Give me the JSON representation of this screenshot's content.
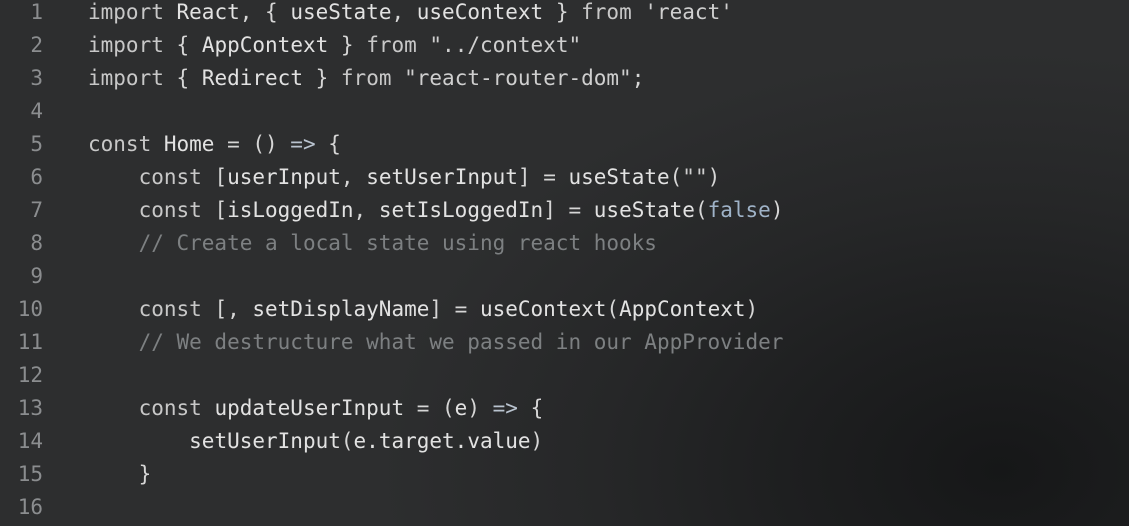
{
  "editor": {
    "lines": [
      {
        "number": "1",
        "tokens": [
          {
            "text": "import ",
            "kind": "kw"
          },
          {
            "text": "React",
            "kind": "id"
          },
          {
            "text": ", { ",
            "kind": "p"
          },
          {
            "text": "useState",
            "kind": "id"
          },
          {
            "text": ", ",
            "kind": "p"
          },
          {
            "text": "useContext",
            "kind": "id"
          },
          {
            "text": " } ",
            "kind": "p"
          },
          {
            "text": "from ",
            "kind": "kw"
          },
          {
            "text": "'react'",
            "kind": "str"
          }
        ]
      },
      {
        "number": "2",
        "tokens": [
          {
            "text": "import ",
            "kind": "kw"
          },
          {
            "text": "{ ",
            "kind": "p"
          },
          {
            "text": "AppContext",
            "kind": "id"
          },
          {
            "text": " } ",
            "kind": "p"
          },
          {
            "text": "from ",
            "kind": "kw"
          },
          {
            "text": "\"../context\"",
            "kind": "str"
          }
        ]
      },
      {
        "number": "3",
        "tokens": [
          {
            "text": "import ",
            "kind": "kw"
          },
          {
            "text": "{ ",
            "kind": "p"
          },
          {
            "text": "Redirect",
            "kind": "id"
          },
          {
            "text": " } ",
            "kind": "p"
          },
          {
            "text": "from ",
            "kind": "kw"
          },
          {
            "text": "\"react-router-dom\"",
            "kind": "str"
          },
          {
            "text": ";",
            "kind": "p"
          }
        ]
      },
      {
        "number": "4",
        "tokens": []
      },
      {
        "number": "5",
        "tokens": [
          {
            "text": "const ",
            "kind": "kw"
          },
          {
            "text": "Home",
            "kind": "id"
          },
          {
            "text": " = () ",
            "kind": "p"
          },
          {
            "text": "=>",
            "kind": "op"
          },
          {
            "text": " {",
            "kind": "p"
          }
        ]
      },
      {
        "number": "6",
        "tokens": [
          {
            "text": "    ",
            "kind": "p"
          },
          {
            "text": "const ",
            "kind": "kw"
          },
          {
            "text": "[",
            "kind": "p"
          },
          {
            "text": "userInput",
            "kind": "id"
          },
          {
            "text": ", ",
            "kind": "p"
          },
          {
            "text": "setUserInput",
            "kind": "id"
          },
          {
            "text": "] = ",
            "kind": "p"
          },
          {
            "text": "useState",
            "kind": "id"
          },
          {
            "text": "(",
            "kind": "p"
          },
          {
            "text": "\"\"",
            "kind": "str"
          },
          {
            "text": ")",
            "kind": "p"
          }
        ]
      },
      {
        "number": "7",
        "tokens": [
          {
            "text": "    ",
            "kind": "p"
          },
          {
            "text": "const ",
            "kind": "kw"
          },
          {
            "text": "[",
            "kind": "p"
          },
          {
            "text": "isLoggedIn",
            "kind": "id"
          },
          {
            "text": ", ",
            "kind": "p"
          },
          {
            "text": "setIsLoggedIn",
            "kind": "id"
          },
          {
            "text": "] = ",
            "kind": "p"
          },
          {
            "text": "useState",
            "kind": "id"
          },
          {
            "text": "(",
            "kind": "p"
          },
          {
            "text": "false",
            "kind": "lit"
          },
          {
            "text": ")",
            "kind": "p"
          }
        ]
      },
      {
        "number": "8",
        "tokens": [
          {
            "text": "    ",
            "kind": "p"
          },
          {
            "text": "// Create a local state using react hooks",
            "kind": "cm"
          }
        ]
      },
      {
        "number": "9",
        "tokens": []
      },
      {
        "number": "10",
        "tokens": [
          {
            "text": "    ",
            "kind": "p"
          },
          {
            "text": "const ",
            "kind": "kw"
          },
          {
            "text": "[, ",
            "kind": "p"
          },
          {
            "text": "setDisplayName",
            "kind": "id"
          },
          {
            "text": "] = ",
            "kind": "p"
          },
          {
            "text": "useContext",
            "kind": "id"
          },
          {
            "text": "(",
            "kind": "p"
          },
          {
            "text": "AppContext",
            "kind": "id"
          },
          {
            "text": ")",
            "kind": "p"
          }
        ]
      },
      {
        "number": "11",
        "tokens": [
          {
            "text": "    ",
            "kind": "p"
          },
          {
            "text": "// We destructure what we passed in our AppProvider",
            "kind": "cm"
          }
        ]
      },
      {
        "number": "12",
        "tokens": []
      },
      {
        "number": "13",
        "tokens": [
          {
            "text": "    ",
            "kind": "p"
          },
          {
            "text": "const ",
            "kind": "kw"
          },
          {
            "text": "updateUserInput",
            "kind": "id"
          },
          {
            "text": " = (",
            "kind": "p"
          },
          {
            "text": "e",
            "kind": "id"
          },
          {
            "text": ") ",
            "kind": "p"
          },
          {
            "text": "=>",
            "kind": "op"
          },
          {
            "text": " {",
            "kind": "p"
          }
        ]
      },
      {
        "number": "14",
        "tokens": [
          {
            "text": "        ",
            "kind": "p"
          },
          {
            "text": "setUserInput",
            "kind": "id"
          },
          {
            "text": "(",
            "kind": "p"
          },
          {
            "text": "e.target.value",
            "kind": "id"
          },
          {
            "text": ")",
            "kind": "p"
          }
        ]
      },
      {
        "number": "15",
        "tokens": [
          {
            "text": "    ",
            "kind": "p"
          },
          {
            "text": "}",
            "kind": "p"
          }
        ]
      },
      {
        "number": "16",
        "tokens": []
      }
    ]
  }
}
